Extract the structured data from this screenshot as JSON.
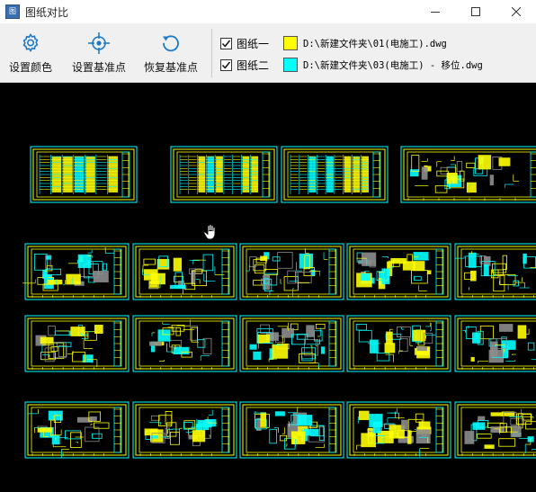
{
  "window": {
    "title": "图纸对比",
    "icon": "app-icon"
  },
  "toolbar": {
    "set_color_label": "设置颜色",
    "set_base_label": "设置基准点",
    "restore_base_label": "恢复基准点"
  },
  "layers": [
    {
      "name": "图纸一",
      "checked": true,
      "color": "#ffff00",
      "path": "D:\\新建文件夹\\01(电施工).dwg"
    },
    {
      "name": "图纸二",
      "checked": true,
      "color": "#00ffff",
      "path": "D:\\新建文件夹\\03(电施工) - 移位.dwg"
    }
  ],
  "colors": {
    "drawing_one": "#ffff00",
    "drawing_two": "#00ffff",
    "grey_overlap": "#8c8c8c",
    "canvas_bg": "#000000",
    "accent": "#1e7ac8"
  }
}
